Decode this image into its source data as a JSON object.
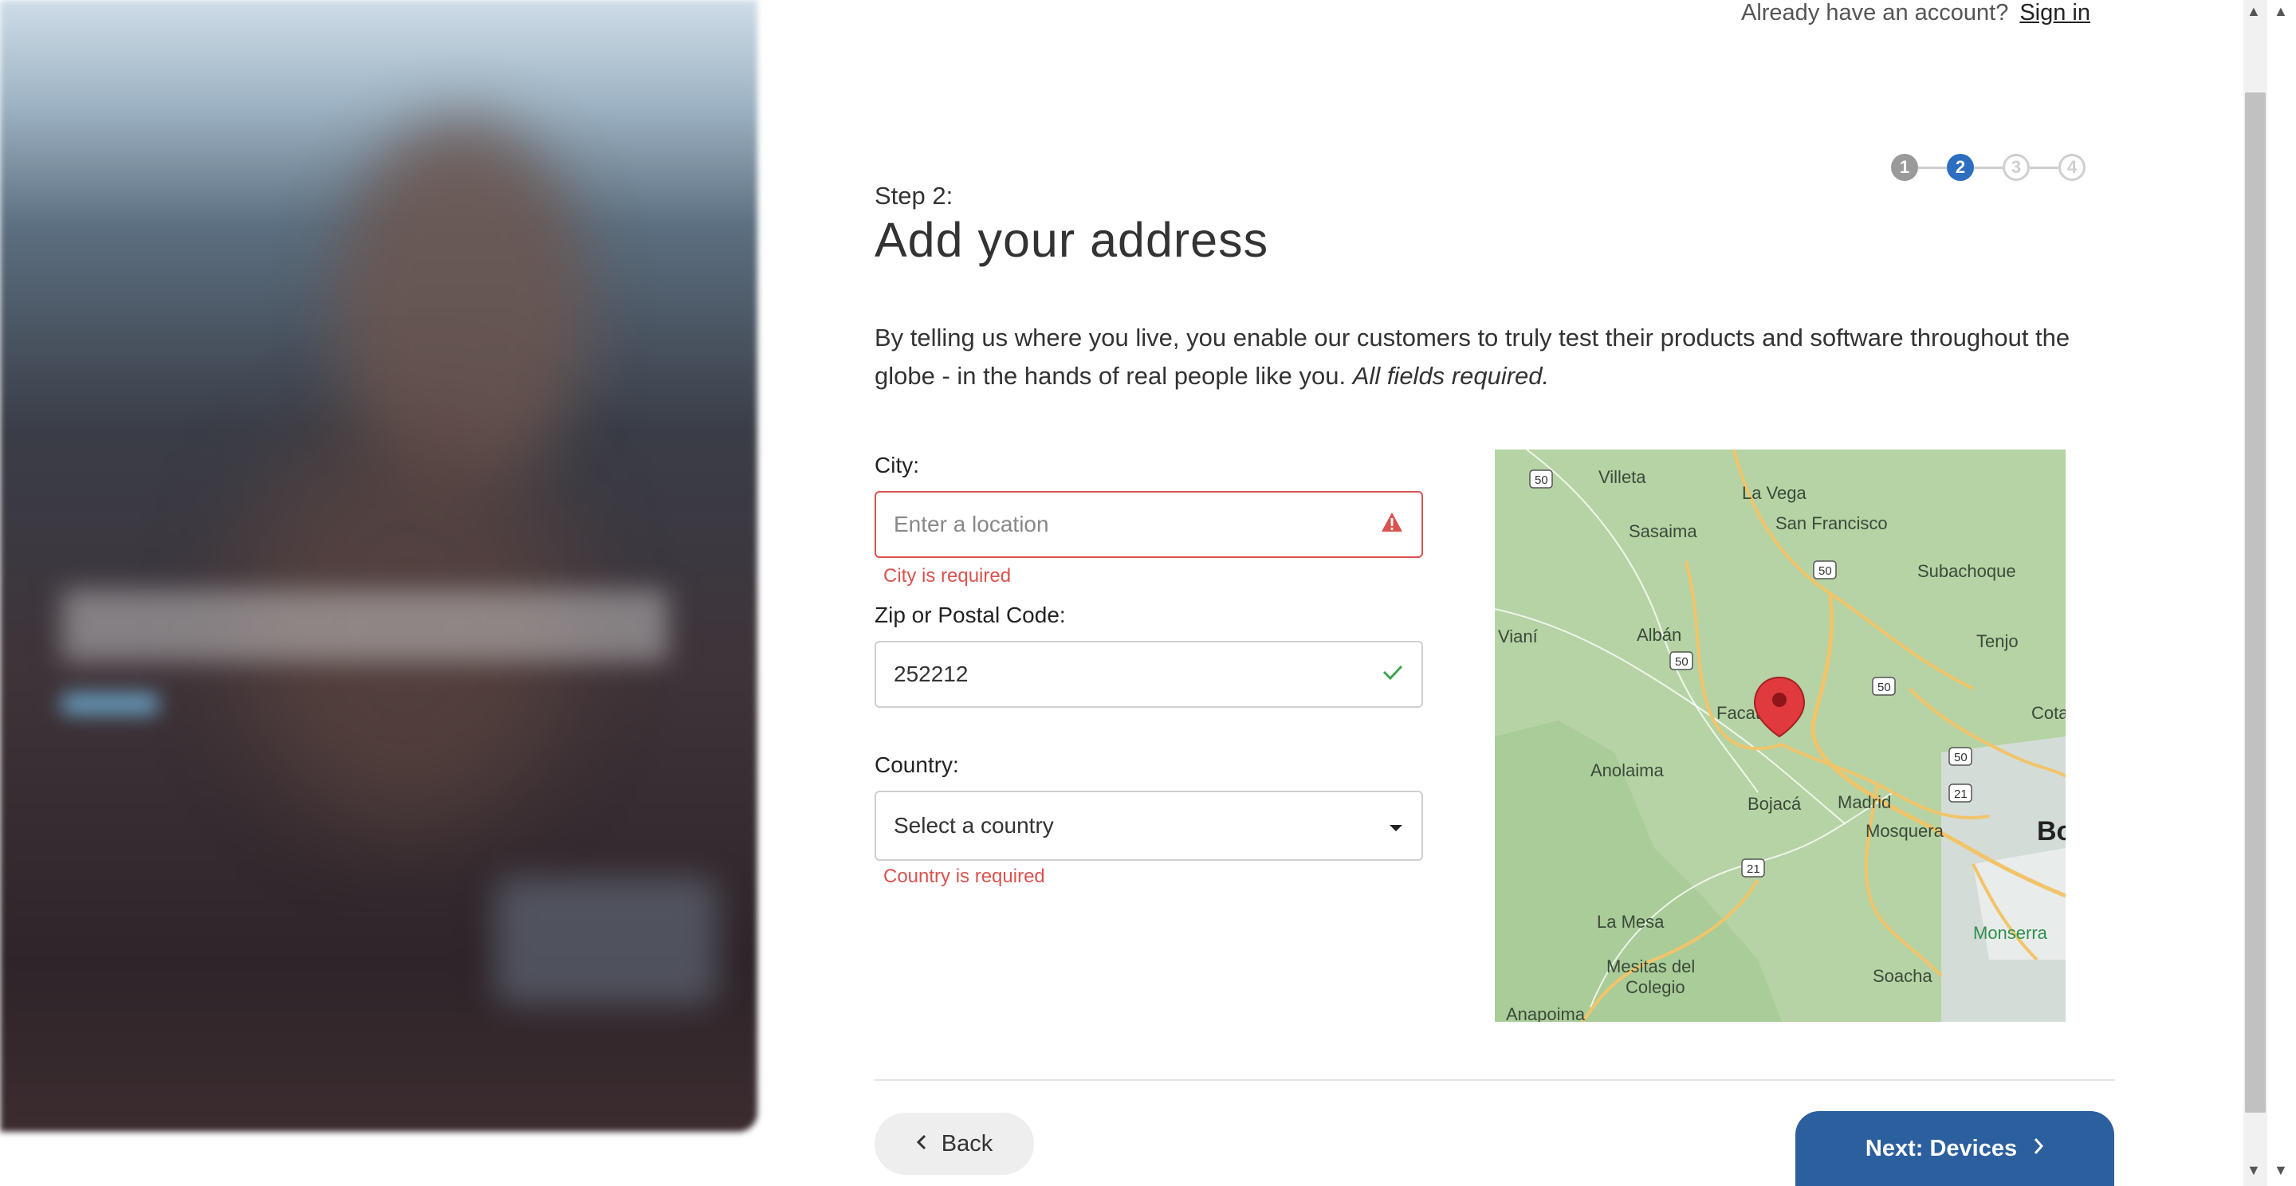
{
  "header": {
    "account_prompt": "Already have an account?",
    "sign_in_label": "Sign in"
  },
  "stepper": {
    "steps": [
      "1",
      "2",
      "3",
      "4"
    ],
    "current": 2
  },
  "step": {
    "label": "Step 2:",
    "title": "Add your address",
    "intro": "By telling us where you live, you enable our customers to truly test their products and software throughout the globe - in the hands of real people like you.",
    "intro_emphasis": "All fields required."
  },
  "form": {
    "city": {
      "label": "City:",
      "placeholder": "Enter a location",
      "error": "City is required"
    },
    "zip": {
      "label": "Zip or Postal Code:",
      "value": "252212"
    },
    "country": {
      "label": "Country:",
      "selected": "Select a country",
      "error": "Country is required"
    }
  },
  "map": {
    "places": [
      "Villeta",
      "La Vega",
      "San Francisco",
      "Sasaima",
      "Subachoque",
      "Vianí",
      "Albán",
      "Tenjo",
      "Facatativá",
      "Cota",
      "Anolaima",
      "Bojacá",
      "Madrid",
      "Mosquera",
      "Bo",
      "La Mesa",
      "Monserra",
      "Mesitas del",
      "Colegio",
      "Soacha",
      "Anapoima"
    ],
    "routes": [
      "50",
      "50",
      "50",
      "50",
      "50",
      "21",
      "21"
    ]
  },
  "actions": {
    "back_label": "Back",
    "next_label": "Next: Devices"
  },
  "colors": {
    "accent": "#2c6fc0",
    "primary_button": "#2c5f9e",
    "error": "#d9534f",
    "success": "#3fa34d"
  }
}
